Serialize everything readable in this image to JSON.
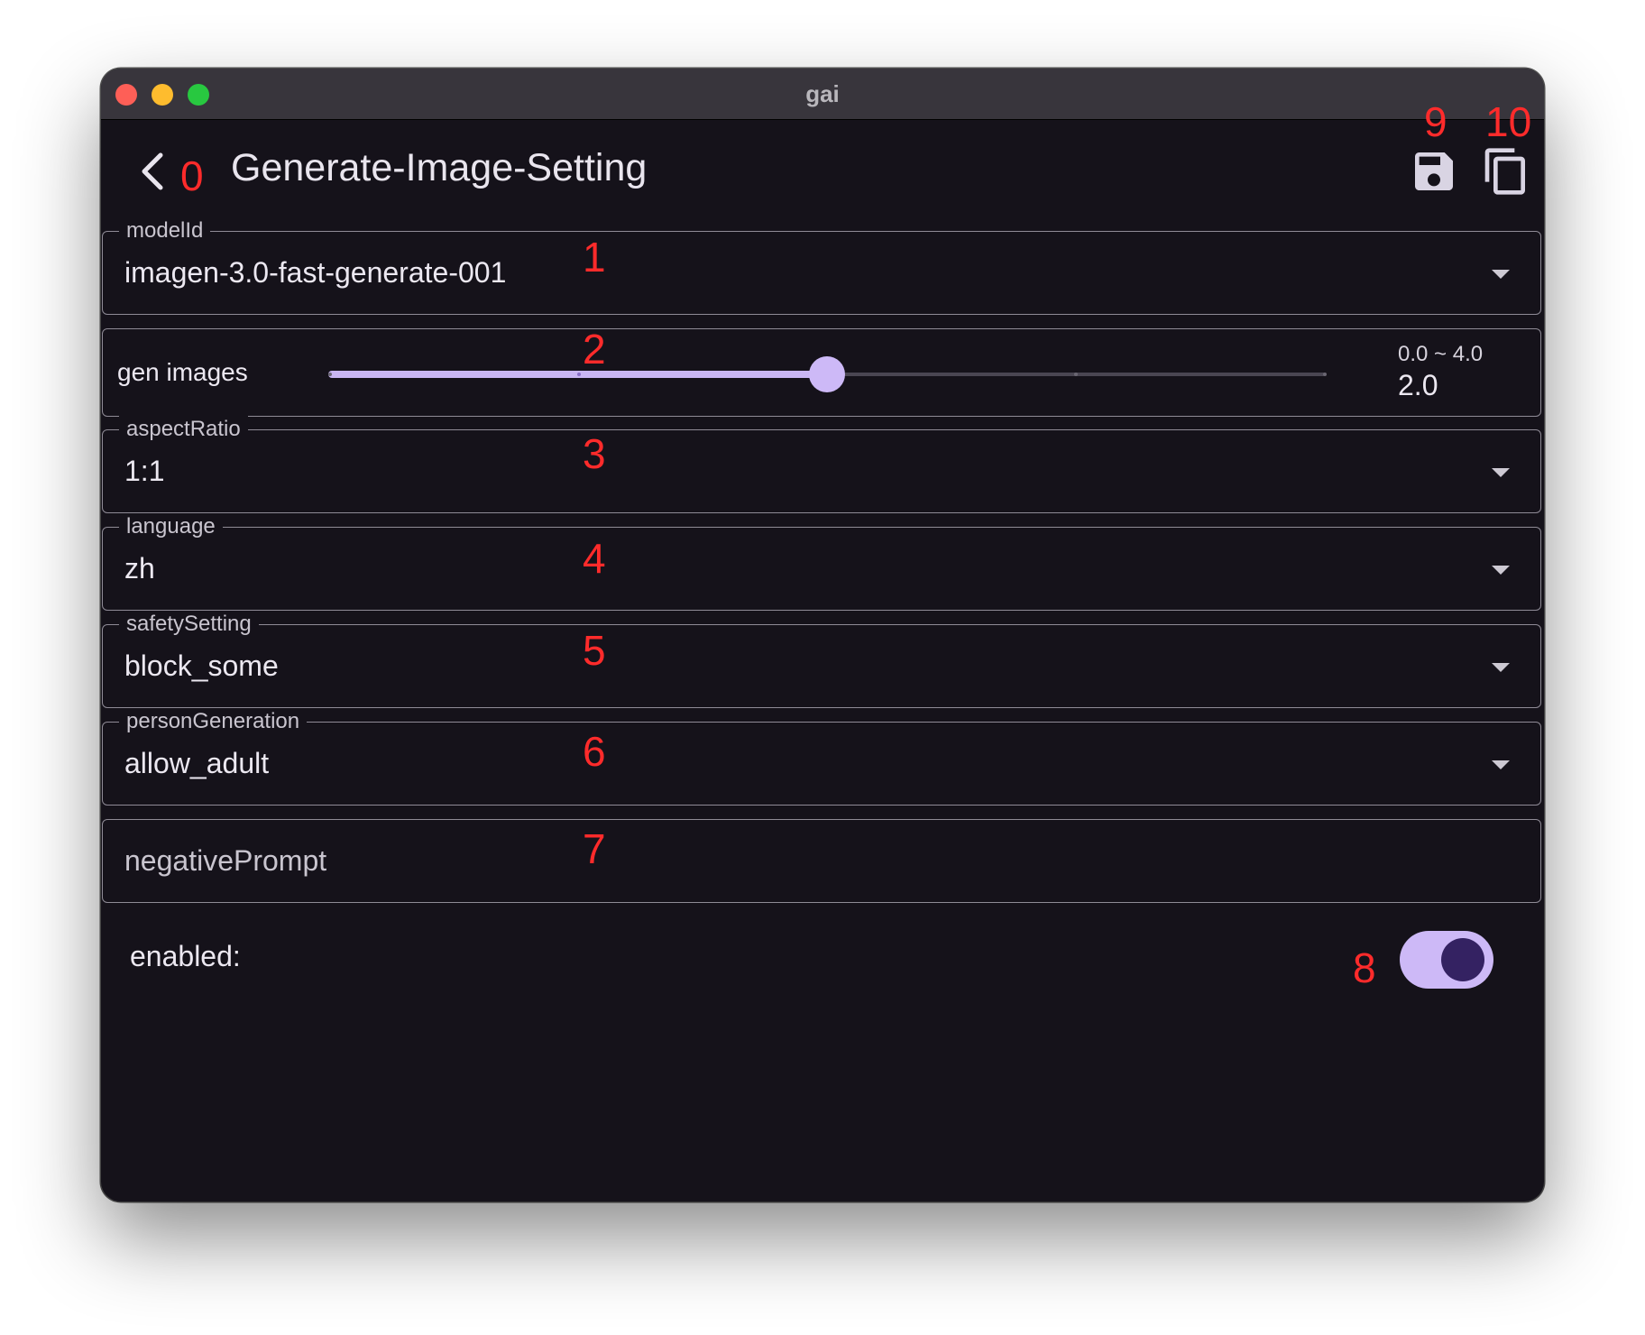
{
  "window": {
    "title": "gai"
  },
  "appbar": {
    "title": "Generate-Image-Setting"
  },
  "annotations": {
    "back": "0",
    "model": "1",
    "slider": "2",
    "aspect": "3",
    "language": "4",
    "safety": "5",
    "person": "6",
    "negative": "7",
    "toggle": "8",
    "save": "9",
    "copy": "10"
  },
  "fields": {
    "model_id": {
      "label": "modelId",
      "value": "imagen-3.0-fast-generate-001"
    },
    "aspect_ratio": {
      "label": "aspectRatio",
      "value": "1:1"
    },
    "language": {
      "label": "language",
      "value": "zh"
    },
    "safety_setting": {
      "label": "safetySetting",
      "value": "block_some"
    },
    "person_generation": {
      "label": "personGeneration",
      "value": "allow_adult"
    },
    "negative_prompt": {
      "placeholder": "negativePrompt",
      "value": ""
    }
  },
  "slider": {
    "label": "gen images",
    "range": "0.0 ~ 4.0",
    "value": "2.0",
    "min": 0,
    "max": 4,
    "current": 2
  },
  "enabled": {
    "label": "enabled:",
    "value": true
  },
  "colors": {
    "accent": "#cdb9f7",
    "background": "#15121a",
    "annotation": "#ff2b2b"
  },
  "icons": {
    "back": "chevron-left-icon",
    "save": "save-icon",
    "copy": "copy-icon"
  }
}
